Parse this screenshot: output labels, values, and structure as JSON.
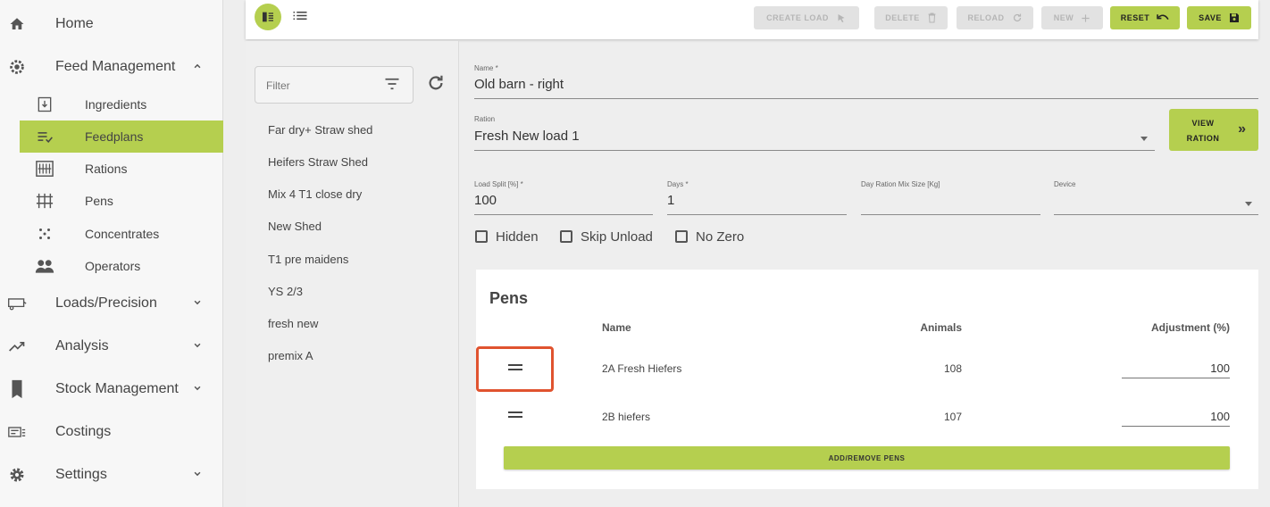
{
  "sidebar": {
    "home": {
      "label": "Home",
      "icon": "home-icon"
    },
    "feed_management": {
      "label": "Feed Management",
      "icon": "feed-gear-icon",
      "items": [
        {
          "label": "Ingredients",
          "icon": "ingredients-icon"
        },
        {
          "label": "Feedplans",
          "icon": "feedplans-icon"
        },
        {
          "label": "Rations",
          "icon": "rations-icon"
        },
        {
          "label": "Pens",
          "icon": "pens-icon"
        },
        {
          "label": "Concentrates",
          "icon": "concentrates-icon"
        },
        {
          "label": "Operators",
          "icon": "operators-icon"
        }
      ],
      "active_index": 1
    },
    "loads": {
      "label": "Loads/Precision",
      "icon": "loads-icon"
    },
    "analysis": {
      "label": "Analysis",
      "icon": "analysis-icon"
    },
    "stock": {
      "label": "Stock Management",
      "icon": "stock-icon"
    },
    "costings": {
      "label": "Costings",
      "icon": "costings-icon"
    },
    "settings": {
      "label": "Settings",
      "icon": "settings-icon"
    }
  },
  "toolbar": {
    "create_load": "CREATE LOAD",
    "delete": "DELETE",
    "reload": "RELOAD",
    "new": "NEW",
    "reset": "RESET",
    "save": "SAVE"
  },
  "filter": {
    "placeholder": "Filter"
  },
  "list": [
    "Far dry+ Straw shed",
    "Heifers Straw Shed",
    "Mix 4 T1 close dry",
    "New Shed",
    "T1 pre maidens",
    "YS 2/3",
    "fresh new",
    "premix A"
  ],
  "form": {
    "name_label": "Name *",
    "name_value": "Old barn - right",
    "ration_label": "Ration",
    "ration_value": "Fresh New load 1",
    "view_ration": "VIEW RATION",
    "load_split_label": "Load Split [%] *",
    "load_split_value": "100",
    "days_label": "Days *",
    "days_value": "1",
    "mix_size_label": "Day Ration Mix Size [Kg]",
    "mix_size_value": "",
    "device_label": "Device",
    "device_value": "",
    "checkboxes": [
      "Hidden",
      "Skip Unload",
      "No Zero"
    ]
  },
  "pens": {
    "title": "Pens",
    "columns": {
      "name": "Name",
      "animals": "Animals",
      "adjustment": "Adjustment (%)"
    },
    "rows": [
      {
        "name": "2A Fresh Hiefers",
        "animals": "108",
        "adjustment": "100"
      },
      {
        "name": "2B hiefers",
        "animals": "107",
        "adjustment": "100"
      }
    ],
    "add_remove": "ADD/REMOVE PENS"
  },
  "colors": {
    "accent": "#b5cf4f",
    "highlight": "#e0532f"
  }
}
